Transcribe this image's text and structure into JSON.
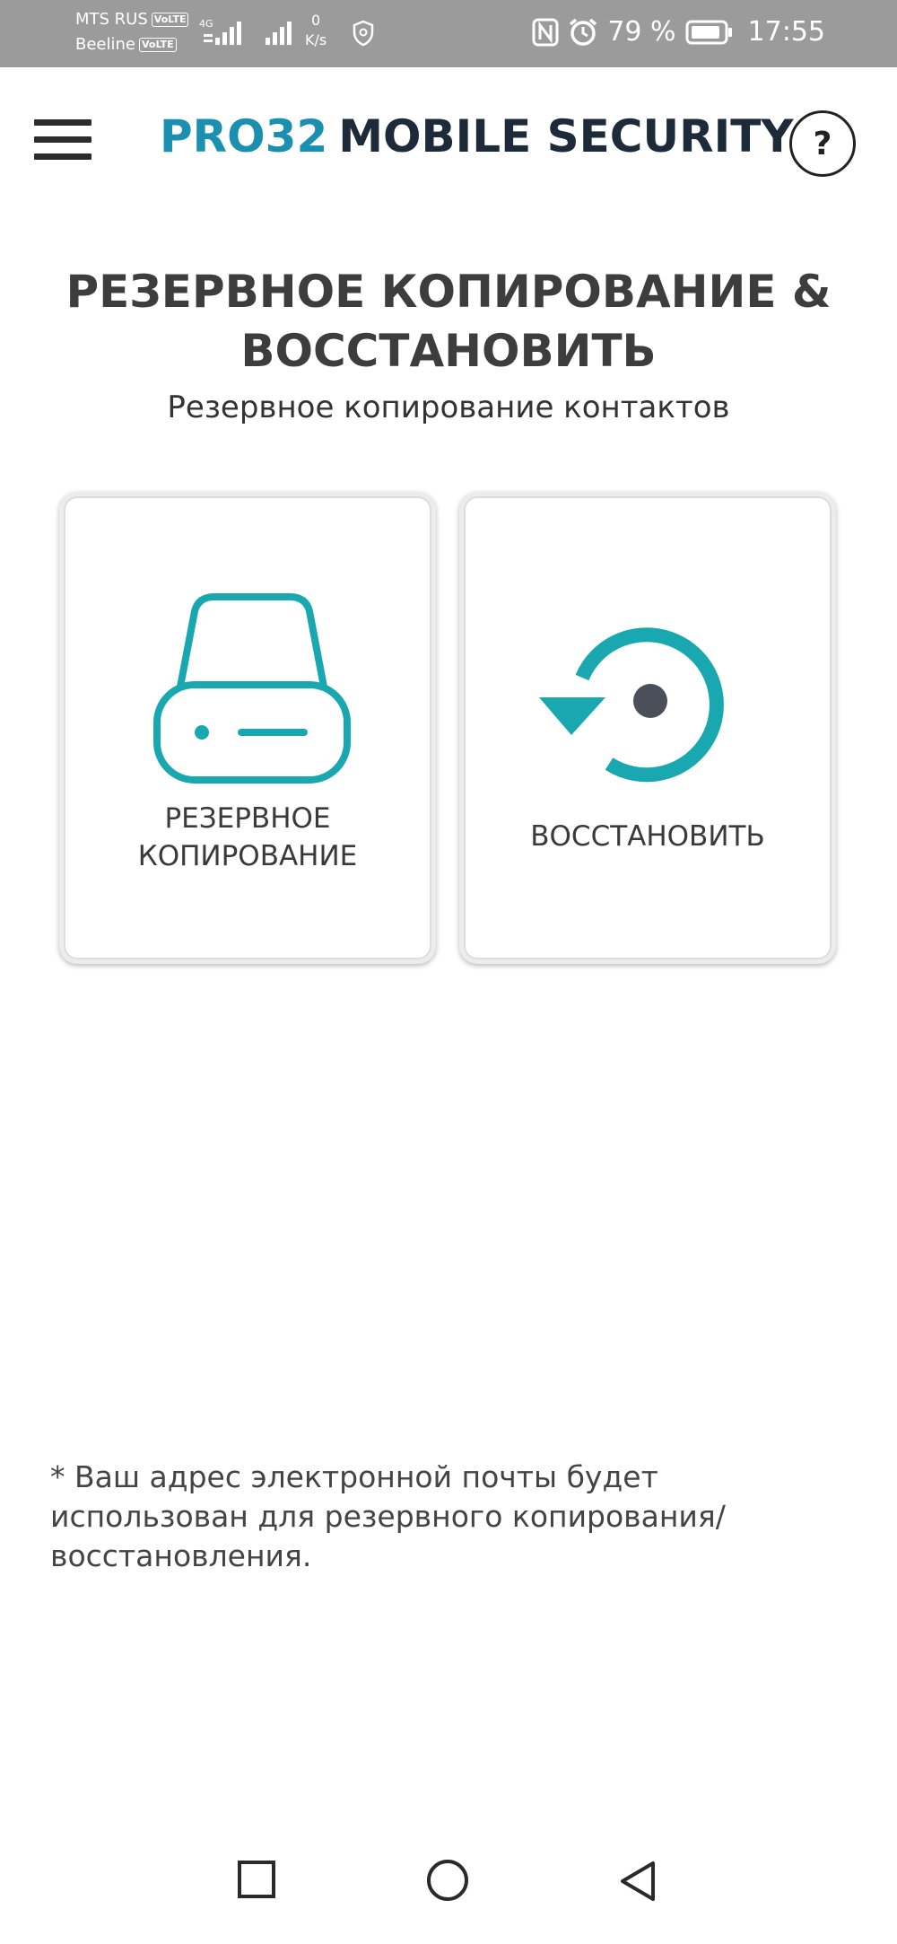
{
  "status_bar": {
    "carrier1": "MTS RUS",
    "carrier2": "Beeline",
    "volte": "VoLTE",
    "network_type": "4G",
    "net_speed_value": "0",
    "net_speed_unit": "K/s",
    "battery": "79 %",
    "time": "17:55"
  },
  "header": {
    "brand_part1": "PRO32",
    "brand_part2": "MOBILE SECURITY",
    "help_label": "?"
  },
  "page": {
    "title_line1": "РЕЗЕРВНОЕ КОПИРОВАНИЕ &",
    "title_line2": "ВОССТАНОВИТЬ",
    "subtitle": "Резервное копирование контактов"
  },
  "cards": {
    "backup": {
      "label_line1": "РЕЗЕРВНОЕ",
      "label_line2": "КОПИРОВАНИЕ",
      "icon": "hard-drive-icon"
    },
    "restore": {
      "label": "ВОССТАНОВИТЬ",
      "icon": "restore-icon"
    }
  },
  "footnote": {
    "line1": "* Ваш адрес электронной почты будет",
    "line2": "использован для резервного копирования/",
    "line3": "восстановления."
  },
  "colors": {
    "accent": "#1aa8b0",
    "dot": "#4a4f5a",
    "status_bar_bg": "#9b9b9b"
  }
}
